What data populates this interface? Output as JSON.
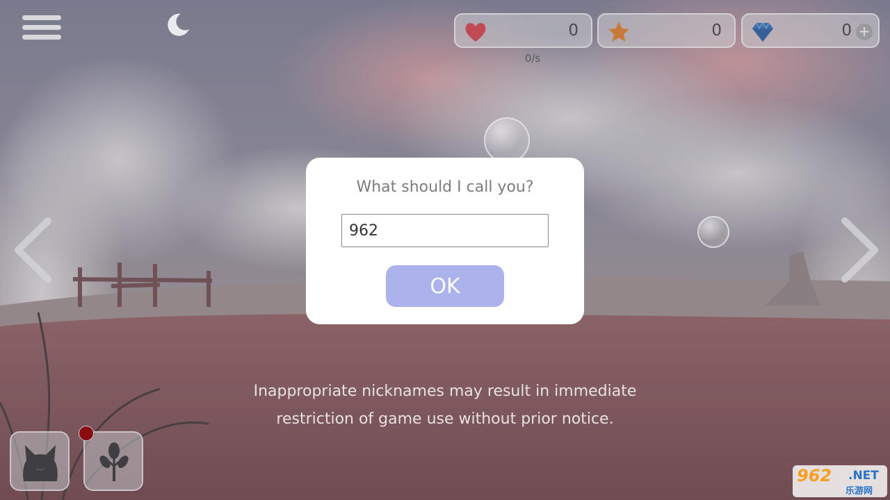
{
  "hud": {
    "resources": [
      {
        "name": "hearts",
        "icon": "heart-icon",
        "value": "0",
        "color": "#c24a55"
      },
      {
        "name": "stars",
        "icon": "star-icon",
        "value": "0",
        "color": "#c97a3a"
      },
      {
        "name": "gems",
        "icon": "gem-icon",
        "value": "0",
        "color": "#3f6fa8"
      }
    ],
    "heart_rate": "0/s",
    "add_icon": "+"
  },
  "dialog": {
    "title": "What should I call you?",
    "name_value": "962",
    "ok_label": "OK"
  },
  "notice": {
    "line1": "Inappropriate nicknames may result in immediate",
    "line2": "restriction of game use without prior notice."
  },
  "bottom_bar": {
    "items": [
      {
        "name": "cat",
        "icon": "cat-icon"
      },
      {
        "name": "tree",
        "icon": "tree-icon"
      }
    ],
    "notification_color": "#8a0c10"
  },
  "watermark": {
    "main": "962",
    "suffix": ".NET",
    "sub": "乐游网"
  },
  "colors": {
    "ok_button": "#abb2ec",
    "dialog_bg": "#ffffff"
  }
}
